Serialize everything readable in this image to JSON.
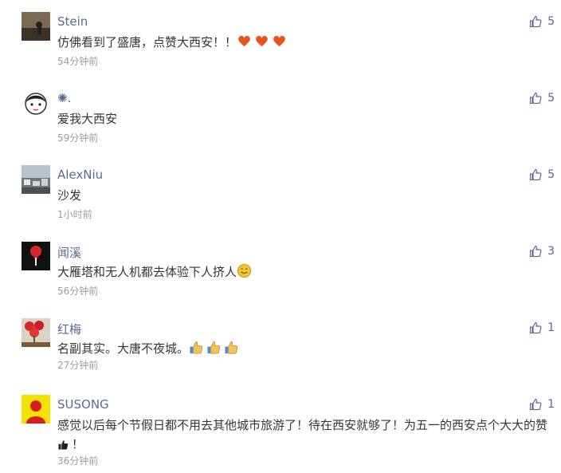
{
  "comments": [
    {
      "name": "Stein",
      "text": "仿佛看到了盛唐，点赞大西安！！",
      "time": "54分钟前",
      "likes": "5",
      "emoji": "heart",
      "emoji_count": 3
    },
    {
      "name": "✺.",
      "text": "爱我大西安",
      "time": "59分钟前",
      "likes": "5"
    },
    {
      "name": "AlexNiu",
      "text": "沙发",
      "time": "1小时前",
      "likes": "5"
    },
    {
      "name": "闻溪",
      "text": "大雁塔和无人机都去体验下人挤人",
      "time": "56分钟前",
      "likes": "3",
      "emoji": "smile",
      "emoji_count": 1
    },
    {
      "name": "红梅",
      "text": "名副其实。大唐不夜城。",
      "time": "27分钟前",
      "likes": "1",
      "emoji": "thumbs-up",
      "emoji_count": 3
    },
    {
      "name": "SUSONG",
      "text": "感觉以后每个节假日都不用去其他城市旅游了！待在西安就够了！为五一的西安点个大大的赞",
      "text_tail": "！",
      "time": "36分钟前",
      "likes": "1",
      "emoji": "thumbs-up-hand",
      "emoji_count": 1
    }
  ],
  "colors": {
    "name": "#576b95",
    "text": "#353535",
    "time": "#9d9d9d",
    "like_icon": "#576b95"
  }
}
